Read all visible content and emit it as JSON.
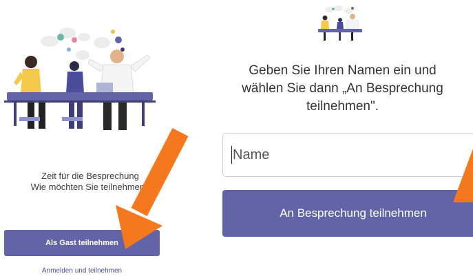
{
  "left_screen": {
    "prompt_line1": "Zeit für die Besprechung",
    "prompt_line2": "Wie möchten Sie teilnehmen?",
    "guest_button": "Als Gast teilnehmen",
    "signin_link": "Anmelden und teilnehmen"
  },
  "right_screen": {
    "prompt_line1": "Geben Sie Ihren Namen ein und",
    "prompt_line2": "wählen Sie dann „An Besprechung",
    "prompt_line3": "teilnehmen\".",
    "name_placeholder": "Name",
    "join_button": "An Besprechung teilnehmen"
  },
  "colors": {
    "accent": "#6264a7",
    "arrow": "#f5781f"
  },
  "icons": [
    "meeting-illustration",
    "arrow-annotation"
  ]
}
